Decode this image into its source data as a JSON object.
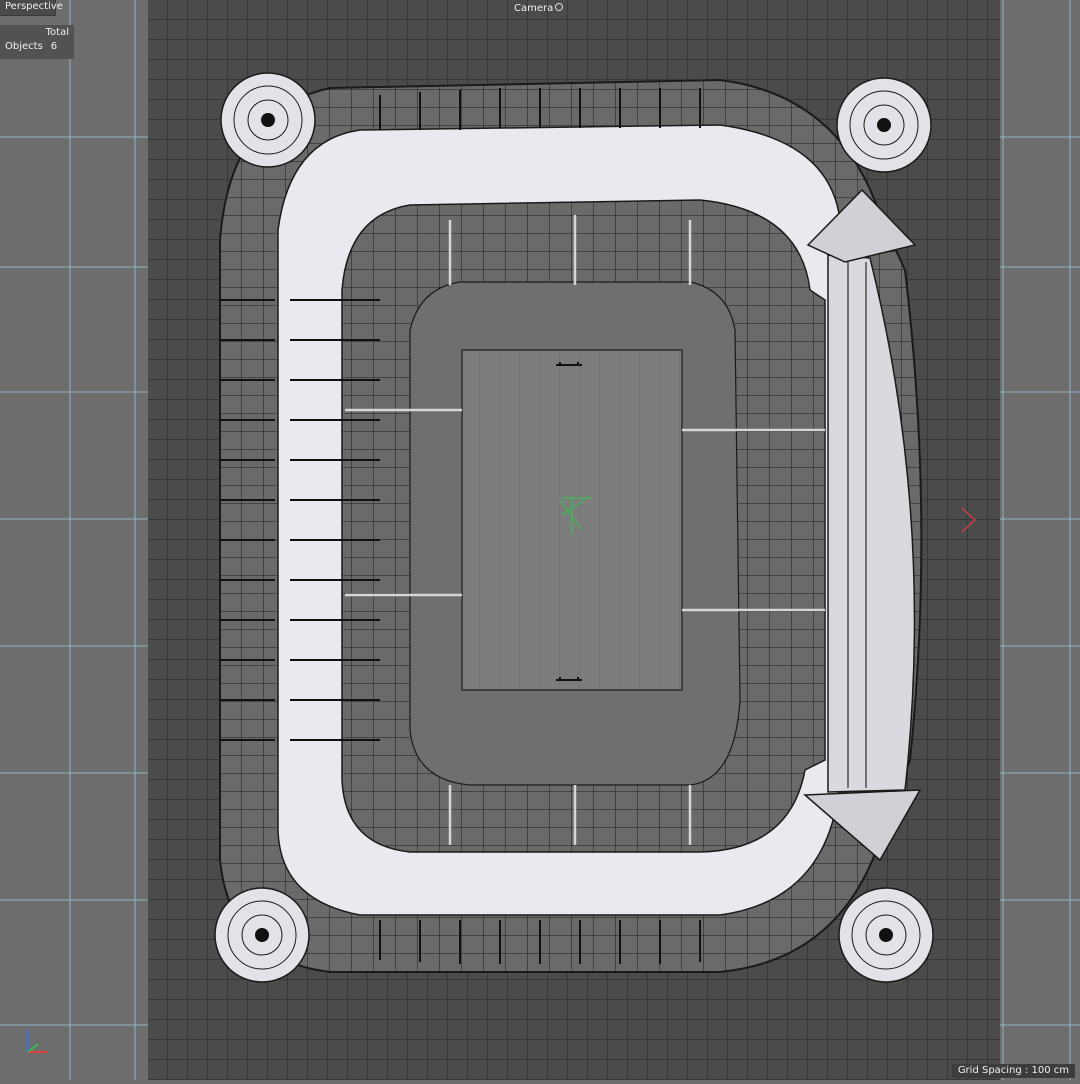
{
  "viewport": {
    "name": "Perspective",
    "camera": "Camera",
    "camera_icon": "camera-switch-icon",
    "stats": {
      "total_label": "Total",
      "objects_label": "Objects",
      "objects_value": "6"
    },
    "grid_spacing": "Grid Spacing : 100 cm"
  },
  "colors": {
    "background": "#6d6d6d",
    "ground_plane": "#4b4b4b",
    "grid_lines": "#8fb3c4",
    "wireframe": "#1a1a1a",
    "light_surface": "#e8eaf0",
    "axis_x": "#d94141",
    "axis_y": "#3dbb52",
    "axis_z": "#3d6fe0"
  }
}
